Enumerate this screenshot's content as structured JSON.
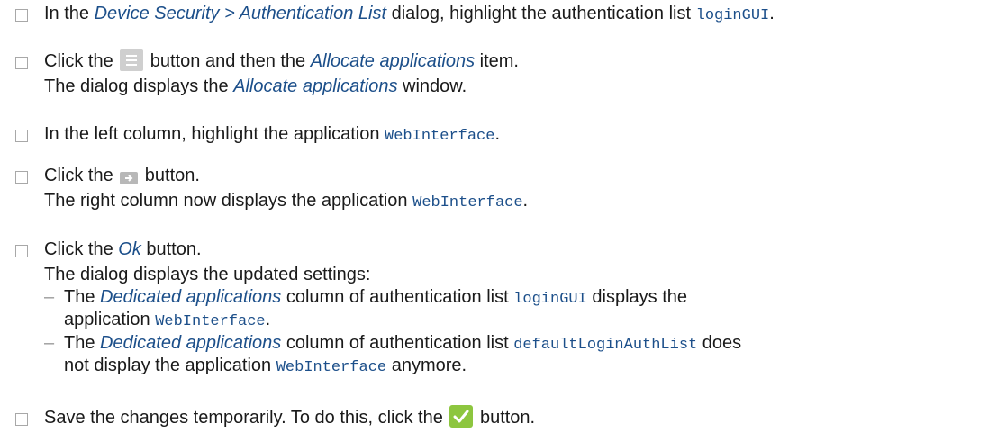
{
  "steps": [
    {
      "parts": {
        "t1": "In the ",
        "ui1": "Device Security > Authentication List",
        "t2": " dialog, highlight the authentication list ",
        "code1": "loginGUI",
        "t3": "."
      }
    },
    {
      "line1": {
        "t1": "Click the ",
        "icon": "menu-icon",
        "t2": " button and then the ",
        "ui1": "Allocate applications",
        "t3": " item."
      },
      "line2": {
        "t1": "The dialog displays the ",
        "ui1": "Allocate applications",
        "t2": " window."
      }
    },
    {
      "parts": {
        "t1": "In the left column, highlight the application ",
        "code1": "WebInterface",
        "t2": "."
      }
    },
    {
      "line1": {
        "t1": "Click the ",
        "icon": "arrow-right-icon",
        "t2": " button."
      },
      "line2": {
        "t1": "The right column now displays the application ",
        "code1": "WebInterface",
        "t2": "."
      }
    },
    {
      "line1": {
        "t1": "Click the ",
        "ui1": "Ok",
        "t2": " button."
      },
      "line2": "The dialog displays the updated settings:",
      "bullets": [
        {
          "dash": "–",
          "t1": "The ",
          "ui1": "Dedicated applications",
          "t2": " column of authentication list ",
          "code1": "loginGUI",
          "t3": " displays the",
          "t4": "application ",
          "code2": "WebInterface",
          "t5": "."
        },
        {
          "dash": "–",
          "t1": "The ",
          "ui1": "Dedicated applications",
          "t2": " column of authentication list ",
          "code1": "defaultLoginAuthList",
          "t3": " does",
          "t4": "not display the application ",
          "code2": "WebInterface",
          "t5": " anymore."
        }
      ]
    },
    {
      "parts": {
        "t1": "Save the changes temporarily. To do this, click the ",
        "icon": "checkmark-icon",
        "t2": " button."
      }
    }
  ],
  "colors": {
    "ui_text": "#1c4f8a",
    "checkbox_border": "#a8a8a8",
    "ok_button": "#8dc63f"
  }
}
